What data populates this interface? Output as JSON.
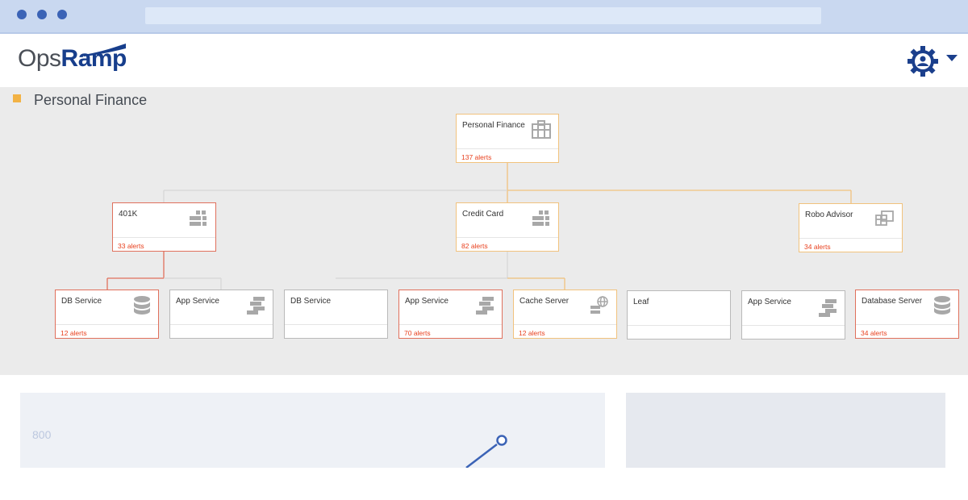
{
  "app": {
    "brand_first": "Ops",
    "brand_second": "Ramp"
  },
  "page": {
    "title": "Personal Finance"
  },
  "tree": {
    "root": {
      "label": "Personal Finance",
      "alerts": "137 alerts",
      "icon": "building-icon"
    },
    "level1": [
      {
        "label": "401K",
        "alerts": "33 alerts",
        "icon": "server-grid-icon",
        "status": "red"
      },
      {
        "label": "Credit Card",
        "alerts": "82 alerts",
        "icon": "server-grid-icon",
        "status": "orange"
      },
      {
        "label": "Robo Advisor",
        "alerts": "34 alerts",
        "icon": "windows-icon",
        "status": "orange"
      }
    ],
    "level2": [
      {
        "label": "DB Service",
        "alerts": "12 alerts",
        "icon": "database-icon",
        "status": "red"
      },
      {
        "label": "App Service",
        "alerts": "",
        "icon": "app-servers-icon",
        "status": "gray"
      },
      {
        "label": "DB Service",
        "alerts": "",
        "icon": "",
        "status": "gray"
      },
      {
        "label": "App Service",
        "alerts": "70 alerts",
        "icon": "app-servers-icon",
        "status": "red"
      },
      {
        "label": "Cache Server",
        "alerts": "12 alerts",
        "icon": "globe-server-icon",
        "status": "orange"
      },
      {
        "label": "Leaf",
        "alerts": "",
        "icon": "",
        "status": "gray"
      },
      {
        "label": "App Service",
        "alerts": "",
        "icon": "app-servers-icon",
        "status": "gray"
      },
      {
        "label": "Database Server",
        "alerts": "34 alerts",
        "icon": "database-icon",
        "status": "red"
      }
    ]
  },
  "chart_preview": {
    "y_tick": "800"
  },
  "colors": {
    "brand_blue": "#173e8c",
    "alert_red": "#e8401e",
    "node_red_border": "#e0705c",
    "node_orange_border": "#f1c27d",
    "accent_yellow": "#f2b245"
  }
}
